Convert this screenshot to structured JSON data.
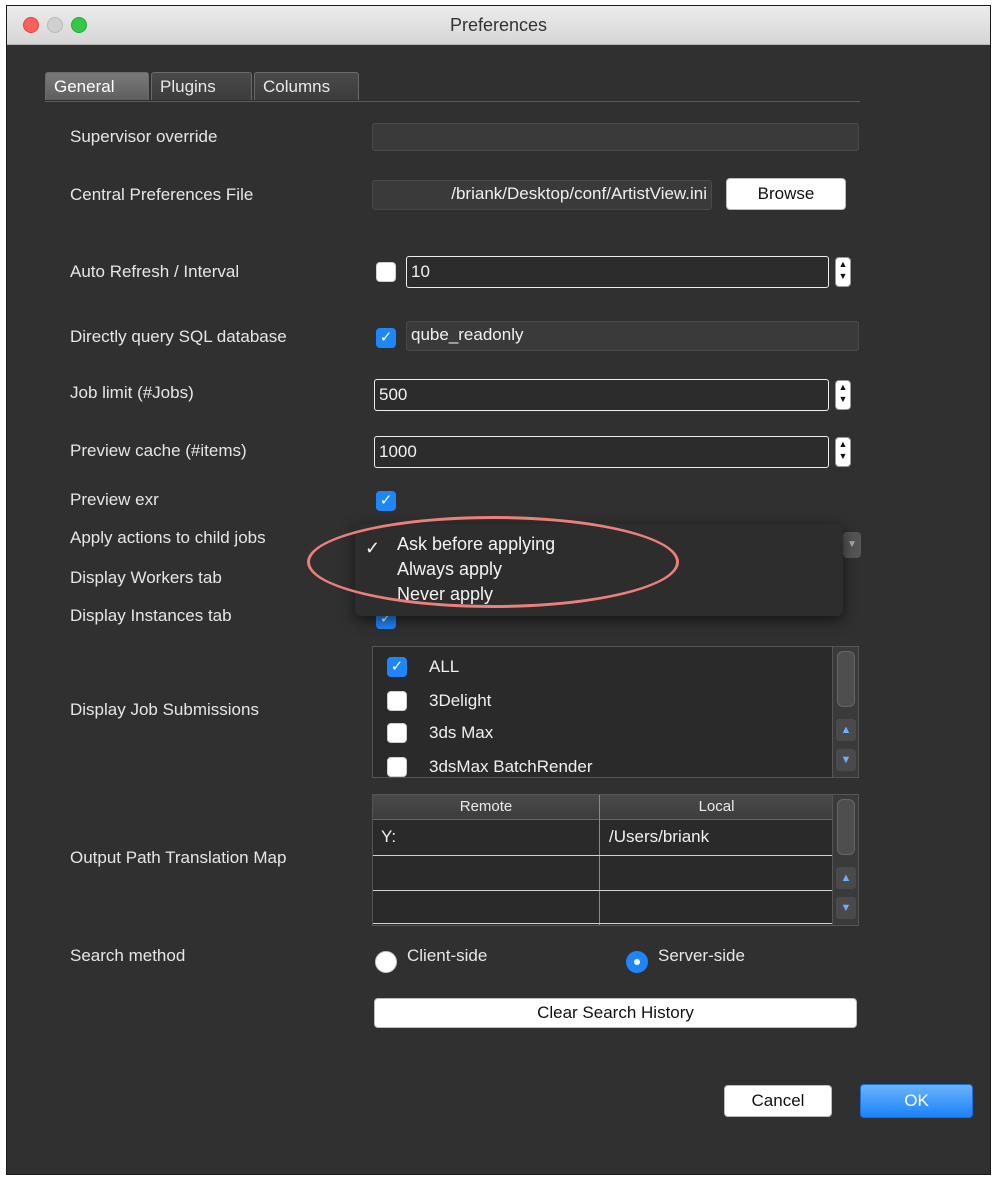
{
  "window": {
    "title": "Preferences"
  },
  "tabs": [
    "General",
    "Plugins",
    "Columns"
  ],
  "fields": {
    "supervisor_override": {
      "label": "Supervisor override",
      "value": ""
    },
    "central_prefs": {
      "label": "Central Preferences File",
      "value": "/briank/Desktop/conf/ArtistView.ini",
      "browse_label": "Browse"
    },
    "auto_refresh": {
      "label": "Auto Refresh / Interval",
      "checked": false,
      "value": "10"
    },
    "direct_sql": {
      "label": "Directly query SQL database",
      "checked": true,
      "value": "qube_readonly"
    },
    "job_limit": {
      "label": "Job limit (#Jobs)",
      "value": "500"
    },
    "preview_cache": {
      "label": "Preview cache (#items)",
      "value": "1000"
    },
    "preview_exr": {
      "label": "Preview exr",
      "checked": true
    },
    "apply_actions": {
      "label": "Apply actions to child jobs"
    },
    "display_workers": {
      "label": "Display Workers tab"
    },
    "display_instances": {
      "label": "Display Instances tab",
      "checked": true
    },
    "display_job_submissions": {
      "label": "Display Job Submissions"
    },
    "output_path_map": {
      "label": "Output Path Translation Map"
    },
    "search_method": {
      "label": "Search method",
      "client_label": "Client-side",
      "server_label": "Server-side",
      "selected": "Server-side"
    }
  },
  "popup": {
    "items": [
      "Ask before applying",
      "Always apply",
      "Never apply"
    ],
    "selected": "Ask before applying"
  },
  "job_submissions": [
    {
      "label": "ALL",
      "checked": true
    },
    {
      "label": "3Delight",
      "checked": false
    },
    {
      "label": "3ds Max",
      "checked": false
    },
    {
      "label": "3dsMax BatchRender",
      "checked": false
    }
  ],
  "path_map": {
    "headers": [
      "Remote",
      "Local"
    ],
    "rows": [
      [
        "Y:",
        "/Users/briank"
      ],
      [
        "",
        ""
      ],
      [
        "",
        ""
      ]
    ]
  },
  "buttons": {
    "clear_history": "Clear Search History",
    "cancel": "Cancel",
    "ok": "OK"
  },
  "glyphs": {
    "check": "✓",
    "stepper_up": "▲",
    "stepper_down": "▼"
  },
  "colors": {
    "accent": "#1f86f8",
    "window_bg": "#303030",
    "highlight_ellipse": "#ec7f7a"
  }
}
